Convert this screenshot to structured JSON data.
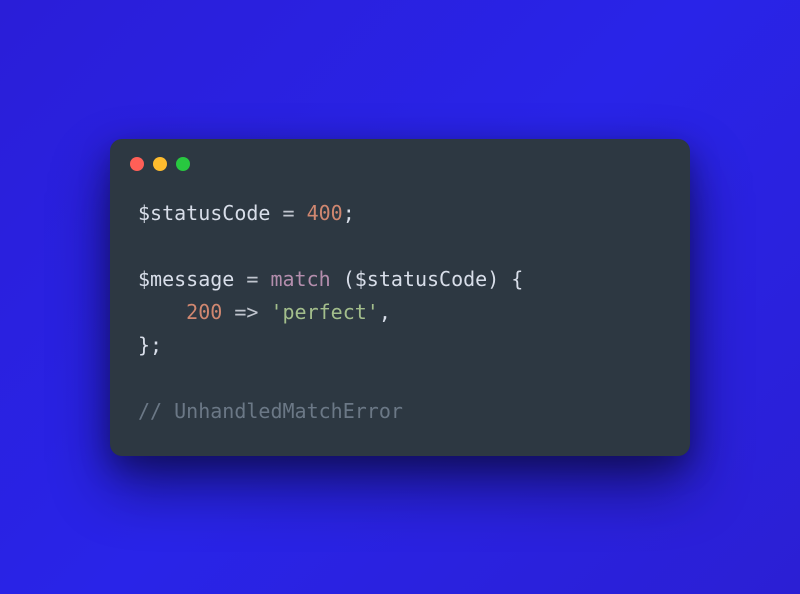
{
  "window": {
    "traffic_lights": [
      "close",
      "minimize",
      "zoom"
    ]
  },
  "code": {
    "line1_var": "$statusCode",
    "line1_eq": " = ",
    "line1_num": "400",
    "line1_end": ";",
    "blank1": "",
    "line3_var": "$message",
    "line3_eq": " = ",
    "line3_kw": "match",
    "line3_open": " (",
    "line3_arg": "$statusCode",
    "line3_close": ") {",
    "line4_indent": "    ",
    "line4_case": "200",
    "line4_arrow": " => ",
    "line4_str": "'perfect'",
    "line4_comma": ",",
    "line5_close": "};",
    "blank2": "",
    "line7_comment": "// UnhandledMatchError"
  }
}
